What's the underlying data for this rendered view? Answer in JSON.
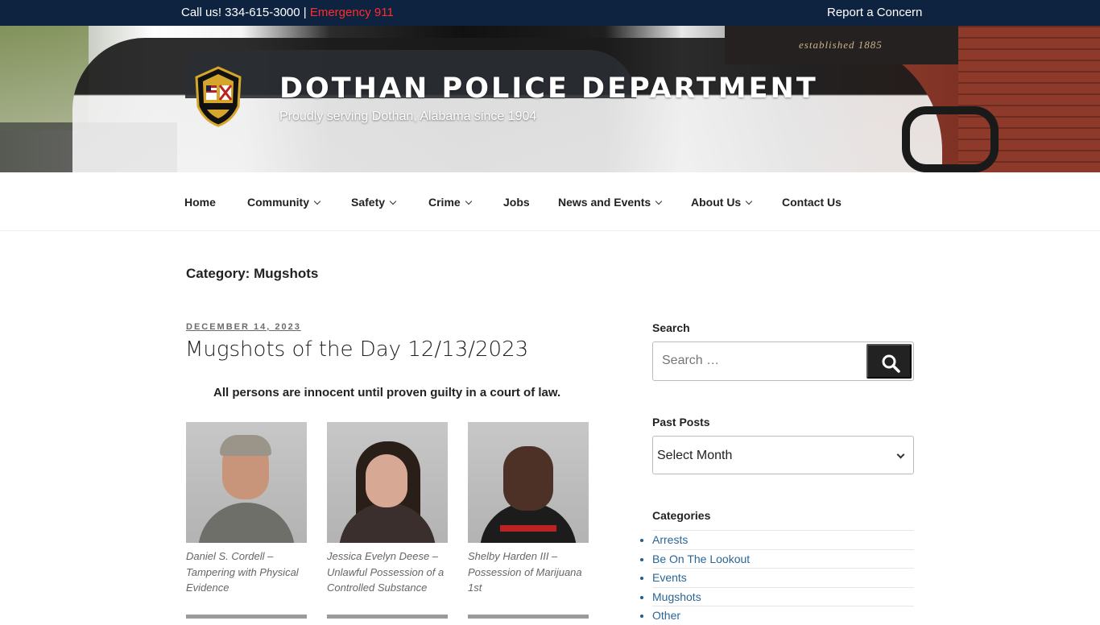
{
  "topbar": {
    "call_text": "Call us! 334-615-3000 |",
    "emergency_text": "Emergency 911",
    "report_link": "Report a Concern"
  },
  "header": {
    "banner_sign": "established 1885",
    "site_title": "DOTHAN POLICE DEPARTMENT",
    "site_description": "Proudly serving Dothan, Alabama since 1904"
  },
  "nav": {
    "items": [
      {
        "label": "Home",
        "has_submenu": false
      },
      {
        "label": "Community",
        "has_submenu": true
      },
      {
        "label": "Safety",
        "has_submenu": true
      },
      {
        "label": "Crime",
        "has_submenu": true
      },
      {
        "label": "Jobs",
        "has_submenu": false
      },
      {
        "label": "News and Events",
        "has_submenu": true
      },
      {
        "label": "About Us",
        "has_submenu": true
      },
      {
        "label": "Contact Us",
        "has_submenu": false
      }
    ]
  },
  "main": {
    "category_title": "Category: Mugshots",
    "post": {
      "date": "DECEMBER 14, 2023",
      "title": "Mugshots of the Day 12/13/2023",
      "disclaimer": "All persons are innocent until proven guilty in a court of law.",
      "mugshots": [
        {
          "caption": "Daniel S. Cordell – Tampering with Physical Evidence"
        },
        {
          "caption": "Jessica Evelyn Deese – Unlawful Possession of a Controlled Substance"
        },
        {
          "caption": "Shelby Harden III – Possession of Marijuana 1st"
        }
      ]
    }
  },
  "sidebar": {
    "search_title": "Search",
    "search_placeholder": "Search …",
    "past_posts_title": "Past Posts",
    "past_posts_select": "Select Month",
    "categories_title": "Categories",
    "categories": [
      "Arrests",
      "Be On The Lookout",
      "Events",
      "Mugshots",
      "Other"
    ]
  },
  "colors": {
    "topbar_bg": "#0e2340",
    "emergency": "#ff2d2d",
    "link": "#2a6597"
  }
}
